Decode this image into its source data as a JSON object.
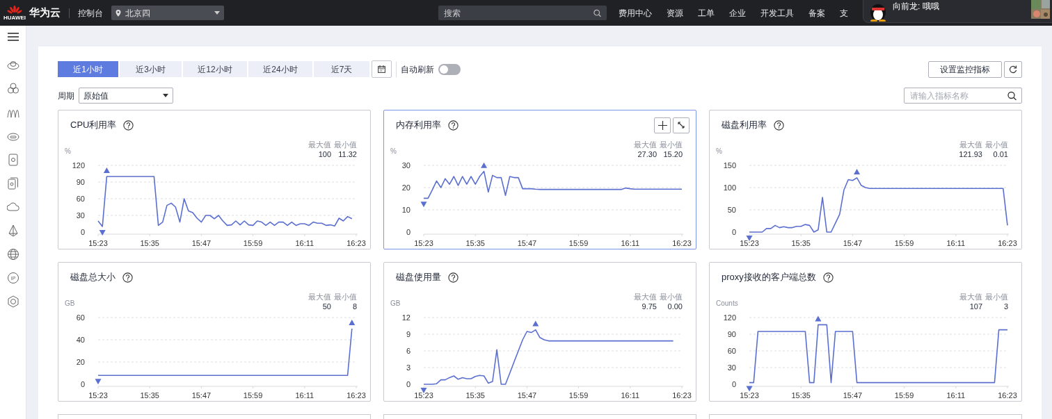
{
  "header": {
    "logo_text": "HUAWEI",
    "brand": "华为云",
    "console": "控制台",
    "region": "北京四",
    "search": {
      "placeholder": "搜索"
    },
    "nav": [
      "费用中心",
      "资源",
      "工单",
      "企业",
      "开发工具",
      "备案",
      "支"
    ],
    "notification": {
      "text": "向前龙: 哦哦"
    }
  },
  "sidebar": {
    "ip_badge": "IP"
  },
  "time_tabs": [
    {
      "label": "近1小时",
      "selected": true
    },
    {
      "label": "近3小时",
      "selected": false
    },
    {
      "label": "近12小时",
      "selected": false
    },
    {
      "label": "近24小时",
      "selected": false
    },
    {
      "label": "近7天",
      "selected": false
    }
  ],
  "auto_refresh": {
    "label": "自动刷新",
    "on": false
  },
  "set_metrics_button": "设置监控指标",
  "period": {
    "label": "周期",
    "value": "原始值"
  },
  "metric_search": {
    "placeholder": "请输入指标名称"
  },
  "charts": [
    {
      "selected": false,
      "max_label": "最大值",
      "min_label": "最小值",
      "max_value": "100",
      "min_value": "11.32",
      "chart_data": {
        "type": "line",
        "title": "CPU利用率",
        "grid": true,
        "ylabel": "%",
        "ylim": [
          0,
          120
        ],
        "yticks": [
          0,
          30,
          60,
          90,
          120
        ],
        "categories": [
          "15:23",
          null,
          null,
          null,
          null,
          null,
          null,
          null,
          null,
          null,
          null,
          null,
          "15:35",
          null,
          null,
          null,
          null,
          null,
          null,
          null,
          null,
          null,
          null,
          null,
          "15:47",
          null,
          null,
          null,
          null,
          null,
          null,
          null,
          null,
          null,
          null,
          null,
          "15:59",
          null,
          null,
          null,
          null,
          null,
          null,
          null,
          null,
          null,
          null,
          null,
          "16:11",
          null,
          null,
          null,
          null,
          null,
          null,
          null,
          null,
          null,
          null,
          null,
          "16:23"
        ],
        "series": [
          {
            "color": "#5b6fd0",
            "values": [
              20,
              10,
              100,
              100,
              100,
              100,
              100,
              100,
              100,
              100,
              100,
              100,
              100,
              100,
              12,
              18,
              48,
              52,
              45,
              18,
              60,
              38,
              35,
              25,
              18,
              30,
              30,
              24,
              30,
              20,
              12,
              13,
              20,
              13,
              20,
              13,
              12,
              20,
              18,
              12,
              18,
              12,
              18,
              18,
              12,
              18,
              12,
              15,
              15,
              12,
              18,
              16,
              16,
              12,
              13,
              11,
              25,
              20,
              28,
              24,
              null
            ]
          }
        ]
      }
    },
    {
      "selected": true,
      "max_label": "最大值",
      "min_label": "最小值",
      "max_value": "27.30",
      "min_value": "15.20",
      "chart_data": {
        "type": "line",
        "title": "内存利用率",
        "grid": true,
        "ylabel": "%",
        "ylim": [
          0,
          30
        ],
        "yticks": [
          0,
          10,
          20,
          30
        ],
        "categories": [
          "15:23",
          null,
          null,
          null,
          null,
          null,
          null,
          null,
          null,
          null,
          null,
          null,
          "15:35",
          null,
          null,
          null,
          null,
          null,
          null,
          null,
          null,
          null,
          null,
          null,
          "15:47",
          null,
          null,
          null,
          null,
          null,
          null,
          null,
          null,
          null,
          null,
          null,
          "15:59",
          null,
          null,
          null,
          null,
          null,
          null,
          null,
          null,
          null,
          null,
          null,
          "16:11",
          null,
          null,
          null,
          null,
          null,
          null,
          null,
          null,
          null,
          null,
          null,
          "16:23"
        ],
        "series": [
          {
            "color": "#5b6fd0",
            "values": [
              15.2,
              15.2,
              19,
              23,
              20,
              24,
              21.5,
              25,
              21,
              25,
              21.5,
              25,
              21.5,
              25,
              27.3,
              18,
              25.5,
              24.5,
              24.5,
              16.5,
              25,
              24.5,
              24.5,
              19.5,
              19.5,
              19.5,
              19.3,
              19.2,
              19.2,
              19.2,
              19.2,
              19.2,
              19.2,
              19.2,
              19.2,
              19.2,
              19.2,
              19.2,
              19.2,
              19.2,
              19.2,
              19.2,
              19.2,
              19.2,
              19.2,
              19.2,
              19.2,
              19.8,
              19.5,
              19.3,
              19.3,
              19.3,
              19.3,
              19.3,
              19.3,
              19.3,
              19.3,
              19.3,
              19.3,
              19.3,
              19.3
            ]
          }
        ]
      }
    },
    {
      "selected": false,
      "max_label": "最大值",
      "min_label": "最小值",
      "max_value": "121.93",
      "min_value": "0.01",
      "chart_data": {
        "type": "line",
        "title": "磁盘利用率",
        "grid": true,
        "ylabel": "%",
        "ylim": [
          0,
          150
        ],
        "yticks": [
          0,
          50,
          100,
          150
        ],
        "categories": [
          "15:23",
          null,
          null,
          null,
          null,
          null,
          null,
          null,
          null,
          null,
          null,
          null,
          "15:35",
          null,
          null,
          null,
          null,
          null,
          null,
          null,
          null,
          null,
          null,
          null,
          "15:47",
          null,
          null,
          null,
          null,
          null,
          null,
          null,
          null,
          null,
          null,
          null,
          "15:59",
          null,
          null,
          null,
          null,
          null,
          null,
          null,
          null,
          null,
          null,
          null,
          "16:11",
          null,
          null,
          null,
          null,
          null,
          null,
          null,
          null,
          null,
          null,
          null,
          "16:23"
        ],
        "series": [
          {
            "color": "#5b6fd0",
            "values": [
              0,
              0,
              0,
              0,
              8,
              8,
              15,
              10,
              12,
              10,
              10,
              13,
              13,
              17,
              15,
              0,
              5,
              78,
              0,
              0,
              20,
              40,
              95,
              118,
              116,
              122,
              105,
              100,
              98,
              98,
              98,
              98,
              98,
              98,
              98,
              98,
              98,
              98,
              98,
              98,
              98,
              98,
              98,
              98,
              98,
              98,
              98,
              98,
              98,
              98,
              98,
              98,
              98,
              98,
              98,
              98,
              98,
              98,
              98,
              98,
              15
            ]
          }
        ]
      }
    },
    {
      "selected": false,
      "max_label": "最大值",
      "min_label": "最小值",
      "max_value": "50",
      "min_value": "8",
      "chart_data": {
        "type": "line",
        "title": "磁盘总大小",
        "grid": true,
        "ylabel": "GB",
        "ylim": [
          0,
          60
        ],
        "yticks": [
          0,
          20,
          40,
          60
        ],
        "categories": [
          "15:23",
          null,
          null,
          null,
          null,
          null,
          null,
          null,
          null,
          null,
          null,
          null,
          "15:35",
          null,
          null,
          null,
          null,
          null,
          null,
          null,
          null,
          null,
          null,
          null,
          "15:47",
          null,
          null,
          null,
          null,
          null,
          null,
          null,
          null,
          null,
          null,
          null,
          "15:59",
          null,
          null,
          null,
          null,
          null,
          null,
          null,
          null,
          null,
          null,
          null,
          "16:11",
          null,
          null,
          null,
          null,
          null,
          null,
          null,
          null,
          null,
          null,
          null,
          "16:23"
        ],
        "series": [
          {
            "color": "#5b6fd0",
            "values": [
              8,
              8,
              8,
              8,
              8,
              8,
              8,
              8,
              8,
              8,
              8,
              8,
              8,
              8,
              8,
              8,
              8,
              8,
              8,
              8,
              8,
              8,
              8,
              8,
              8,
              8,
              8,
              8,
              8,
              8,
              8,
              8,
              8,
              8,
              8,
              8,
              8,
              8,
              8,
              8,
              8,
              8,
              8,
              8,
              8,
              8,
              8,
              8,
              8,
              8,
              8,
              8,
              8,
              8,
              8,
              8,
              8,
              8,
              8,
              50,
              null
            ]
          }
        ]
      }
    },
    {
      "selected": false,
      "max_label": "最大值",
      "min_label": "最小值",
      "max_value": "9.75",
      "min_value": "0.00",
      "chart_data": {
        "type": "line",
        "title": "磁盘使用量",
        "grid": true,
        "ylabel": "GB",
        "ylim": [
          0,
          12
        ],
        "yticks": [
          0,
          3,
          6,
          9,
          12
        ],
        "categories": [
          "15:23",
          null,
          null,
          null,
          null,
          null,
          null,
          null,
          null,
          null,
          null,
          null,
          "15:35",
          null,
          null,
          null,
          null,
          null,
          null,
          null,
          null,
          null,
          null,
          null,
          "15:47",
          null,
          null,
          null,
          null,
          null,
          null,
          null,
          null,
          null,
          null,
          null,
          "15:59",
          null,
          null,
          null,
          null,
          null,
          null,
          null,
          null,
          null,
          null,
          null,
          "16:11",
          null,
          null,
          null,
          null,
          null,
          null,
          null,
          null,
          null,
          null,
          null,
          "16:23"
        ],
        "series": [
          {
            "color": "#5b6fd0",
            "values": [
              0,
              0,
              0,
              0.1,
              0.8,
              0.8,
              1.2,
              1.5,
              0.9,
              1.2,
              1,
              1,
              1.4,
              1.6,
              1.5,
              0.2,
              0.5,
              6.2,
              0,
              0,
              2,
              4,
              6,
              8,
              9.5,
              9.3,
              9.8,
              8.4,
              8,
              7.8,
              7.8,
              7.8,
              7.8,
              7.8,
              7.8,
              7.8,
              7.8,
              7.8,
              7.8,
              7.8,
              7.8,
              7.8,
              7.8,
              7.8,
              7.8,
              7.8,
              7.8,
              7.8,
              7.8,
              7.8,
              7.8,
              7.8,
              7.8,
              7.8,
              7.8,
              7.8,
              7.8,
              7.8,
              7.8,
              null,
              null
            ]
          }
        ]
      }
    },
    {
      "selected": false,
      "max_label": "最大值",
      "min_label": "最小值",
      "max_value": "107",
      "min_value": "3",
      "chart_data": {
        "type": "line",
        "title": "proxy接收的客户端总数",
        "grid": true,
        "ylabel": "Counts",
        "ylim": [
          0,
          120
        ],
        "yticks": [
          0,
          30,
          60,
          90,
          120
        ],
        "categories": [
          "15:23",
          null,
          null,
          null,
          null,
          null,
          null,
          null,
          null,
          null,
          null,
          null,
          "15:35",
          null,
          null,
          null,
          null,
          null,
          null,
          null,
          null,
          null,
          null,
          null,
          "15:47",
          null,
          null,
          null,
          null,
          null,
          null,
          null,
          null,
          null,
          null,
          null,
          "15:59",
          null,
          null,
          null,
          null,
          null,
          null,
          null,
          null,
          null,
          null,
          null,
          "16:11",
          null,
          null,
          null,
          null,
          null,
          null,
          null,
          null,
          null,
          null,
          null,
          "16:23"
        ],
        "series": [
          {
            "color": "#5b6fd0",
            "values": [
              3,
              3,
              95,
              95,
              95,
              95,
              95,
              95,
              95,
              95,
              95,
              95,
              95,
              95,
              3,
              3,
              107,
              107,
              107,
              3,
              95,
              95,
              95,
              95,
              95,
              3,
              3,
              3,
              3,
              3,
              3,
              3,
              3,
              3,
              3,
              3,
              3,
              3,
              3,
              3,
              3,
              3,
              3,
              3,
              3,
              3,
              3,
              3,
              3,
              3,
              3,
              3,
              3,
              3,
              3,
              3,
              3,
              3,
              98,
              98,
              98
            ]
          }
        ]
      }
    }
  ]
}
